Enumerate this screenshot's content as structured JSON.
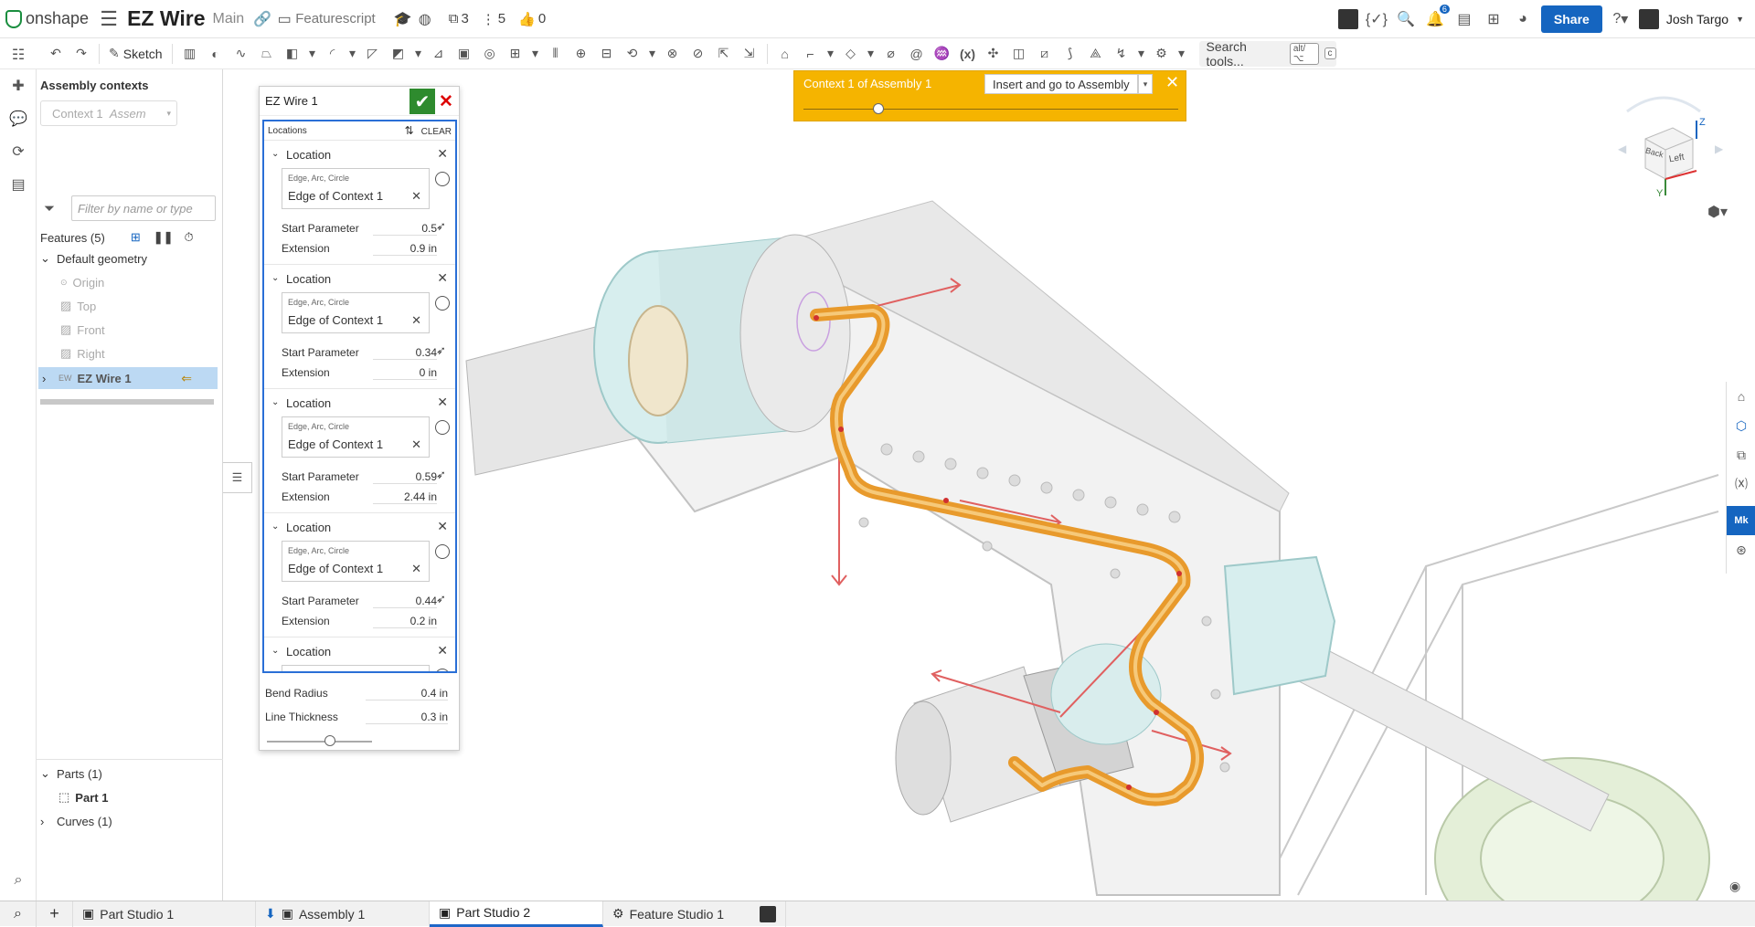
{
  "app": {
    "brand": "onshape",
    "doc_title": "EZ Wire",
    "branch": "Main",
    "workspace_link": "Featurescript"
  },
  "header_stats": {
    "versions": "3",
    "branches": "5",
    "likes": "0",
    "notifications": "6"
  },
  "header": {
    "share_label": "Share",
    "user_name": "Josh Targo",
    "help": "?"
  },
  "toolbar": {
    "sketch_label": "Sketch",
    "search_label": "Search tools...",
    "search_shortcut1": "alt/⌥",
    "search_shortcut2": "c",
    "fx_label": "(x)"
  },
  "assembly_contexts": {
    "title": "Assembly contexts",
    "context_value": "Context 1",
    "context_sub": "Assem"
  },
  "features": {
    "filter_placeholder": "Filter by name or type",
    "header": "Features (5)",
    "default_geometry": "Default geometry",
    "items": [
      "Origin",
      "Top",
      "Front",
      "Right"
    ],
    "ez_badge": "EW",
    "ez_wire": "EZ Wire 1",
    "parts_header": "Parts (1)",
    "part_item": "Part 1",
    "curves_header": "Curves (1)"
  },
  "dialog": {
    "title": "EZ Wire 1",
    "locations_label": "Locations",
    "clear_label": "CLEAR",
    "location_label": "Location",
    "edge_hint": "Edge, Arc, Circle",
    "start_param_label": "Start Parameter",
    "extension_label": "Extension",
    "locations": [
      {
        "edge": "Edge of Context 1",
        "start": "0.5",
        "extension": "0.9 in"
      },
      {
        "edge": "Edge of Context 1",
        "start": "0.34",
        "extension": "0 in"
      },
      {
        "edge": "Edge of Context 1",
        "start": "0.59",
        "extension": "2.44 in"
      },
      {
        "edge": "Edge of Context 1",
        "start": "0.44",
        "extension": "0.2 in"
      }
    ],
    "bend_radius_label": "Bend Radius",
    "bend_radius": "0.4 in",
    "line_thickness_label": "Line Thickness",
    "line_thickness": "0.3 in",
    "slider_level": 0.6
  },
  "context_bar": {
    "title": "Context 1 of Assembly 1",
    "insert_label": "Insert and go to Assembly",
    "slider_level": 0.2
  },
  "viewcube": {
    "back": "Back",
    "left": "Left",
    "z": "Z",
    "y": "Y"
  },
  "tabs": [
    {
      "label": "Part Studio 1",
      "active": false
    },
    {
      "label": "Assembly 1",
      "active": false
    },
    {
      "label": "Part Studio 2",
      "active": true
    },
    {
      "label": "Feature Studio 1",
      "active": false
    }
  ],
  "colors": {
    "accent": "#1565c0",
    "wire": "#e89a2c",
    "context_bar": "#f5b400",
    "selection": "#bcd9f3",
    "ok_green": "#2e8b2e"
  }
}
